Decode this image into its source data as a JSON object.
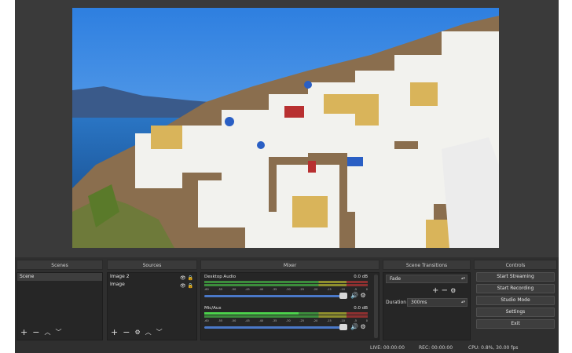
{
  "docks": {
    "scenes": {
      "title": "Scenes",
      "items": [
        "Scene"
      ]
    },
    "sources": {
      "title": "Sources",
      "items": [
        "Image 2",
        "Image"
      ]
    },
    "mixer": {
      "title": "Mixer",
      "channels": [
        {
          "name": "Desktop Audio",
          "level": "0.0 dB"
        },
        {
          "name": "Mic/Aux",
          "level": "0.0 dB"
        }
      ],
      "ticks": [
        "-60",
        "-55",
        "-50",
        "-45",
        "-40",
        "-35",
        "-30",
        "-25",
        "-20",
        "-15",
        "-10",
        "-5",
        "0"
      ]
    },
    "transitions": {
      "title": "Scene Transitions",
      "selected": "Fade",
      "duration_label": "Duration",
      "duration_value": "300ms"
    },
    "controls": {
      "title": "Controls",
      "buttons": [
        "Start Streaming",
        "Start Recording",
        "Studio Mode",
        "Settings",
        "Exit"
      ]
    }
  },
  "status": {
    "live": "LIVE: 00:00:00",
    "rec": "REC: 00:00:00",
    "cpu": "CPU: 0.8%, 30.00 fps"
  },
  "icons": {
    "add": "+",
    "remove": "−",
    "up": "︿",
    "down": "﹀",
    "gear": "⚙",
    "eye": "👁",
    "lock": "🔒",
    "speaker": "🔊"
  },
  "colors": {
    "panel": "#262626",
    "meter_green": "#4cd24c",
    "fader_blue": "#4a78c8",
    "sky": "#3f8be0",
    "sea": "#2a6fb5"
  }
}
